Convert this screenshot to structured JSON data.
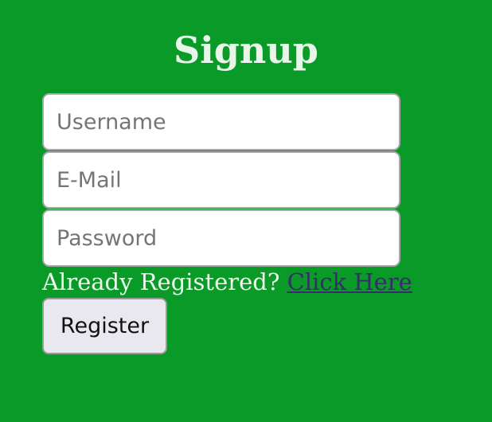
{
  "form": {
    "title": "Signup",
    "username_placeholder": "Username",
    "email_placeholder": "E-Mail",
    "password_placeholder": "Password",
    "login_prompt": "Already Registered?",
    "login_link": "Click Here",
    "register_label": "Register"
  },
  "colors": {
    "background": "#0a9a28",
    "link": "#3a2a6e"
  }
}
